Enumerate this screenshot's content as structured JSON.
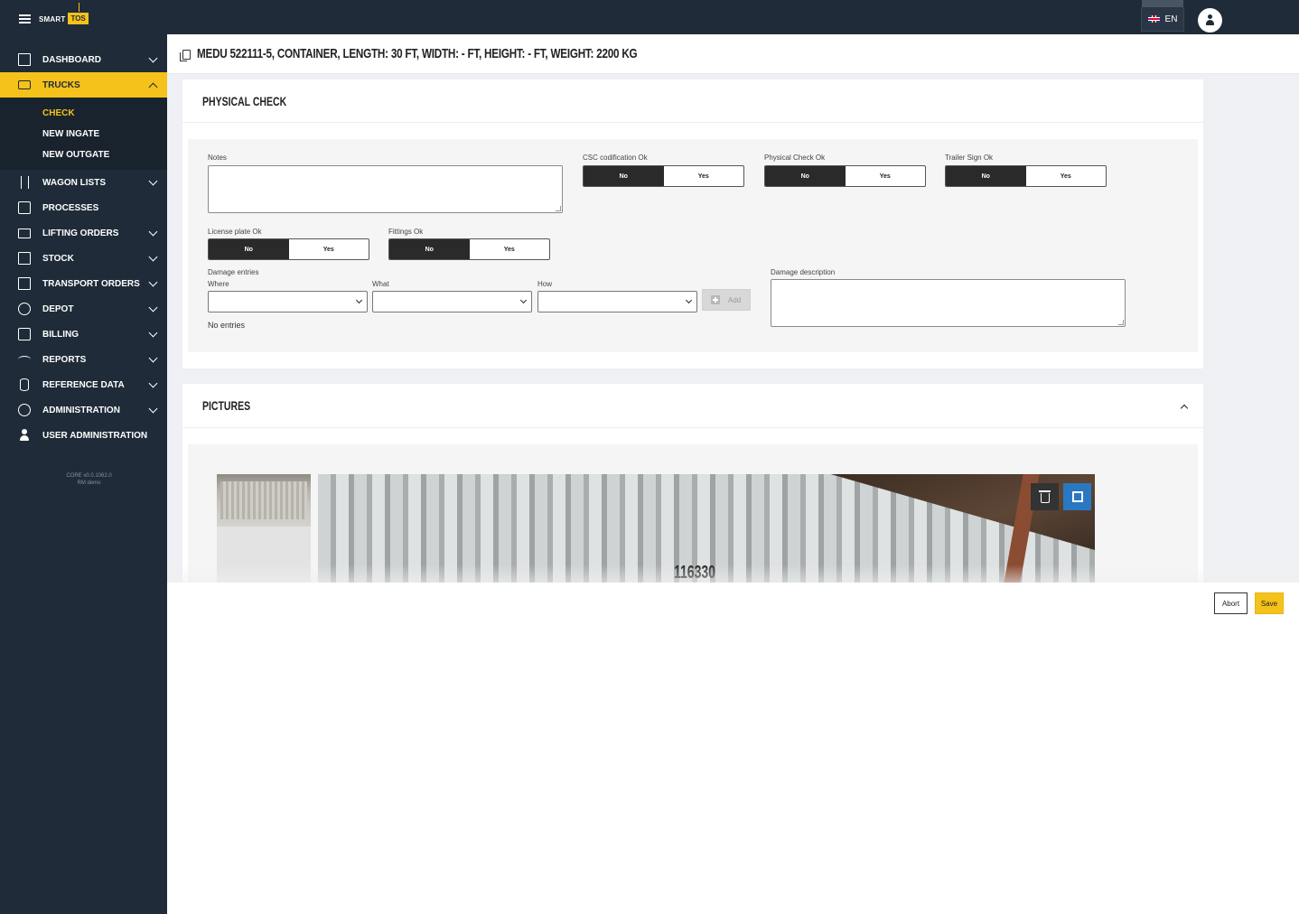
{
  "app": {
    "logo_text_left": "SMART",
    "logo_text_right": "TOS",
    "language": "EN"
  },
  "sidebar": {
    "items": [
      {
        "label": "DASHBOARD",
        "icon": "dashboard-icon"
      },
      {
        "label": "TRUCKS",
        "icon": "truck-icon",
        "active": true
      },
      {
        "label": "WAGON LISTS",
        "icon": "railway-icon"
      },
      {
        "label": "PROCESSES",
        "icon": "process-icon"
      },
      {
        "label": "LIFTING ORDERS",
        "icon": "crane-icon"
      },
      {
        "label": "STOCK",
        "icon": "container-icon"
      },
      {
        "label": "TRANSPORT ORDERS",
        "icon": "calendar-icon"
      },
      {
        "label": "DEPOT",
        "icon": "tools-icon"
      },
      {
        "label": "BILLING",
        "icon": "billing-icon"
      },
      {
        "label": "REPORTS",
        "icon": "gauge-icon"
      },
      {
        "label": "REFERENCE DATA",
        "icon": "database-icon"
      },
      {
        "label": "ADMINISTRATION",
        "icon": "gear-icon"
      },
      {
        "label": "USER ADMINISTRATION",
        "icon": "user-icon"
      }
    ],
    "submenu": [
      {
        "label": "CHECK",
        "current": true
      },
      {
        "label": "NEW INGATE"
      },
      {
        "label": "NEW OUTGATE"
      }
    ],
    "version_line1": "CORE v0.0.1062.0",
    "version_line2": "RM demo"
  },
  "header": {
    "title": "MEDU 522111-5, CONTAINER, LENGTH: 30 FT, WIDTH: - FT, HEIGHT: - FT, WEIGHT: 2200 KG"
  },
  "physical_check": {
    "title": "PHYSICAL CHECK",
    "notes_label": "Notes",
    "csc_label": "CSC codification Ok",
    "physical_label": "Physical Check Ok",
    "trailer_label": "Trailer Sign Ok",
    "license_label": "License plate Ok",
    "fittings_label": "Fittings Ok",
    "no": "No",
    "yes": "Yes",
    "damage_entries_label": "Damage entries",
    "where_label": "Where",
    "what_label": "What",
    "how_label": "How",
    "add_label": "Add",
    "no_entries": "No entries",
    "damage_description_label": "Damage description"
  },
  "pictures": {
    "title": "PICTURES",
    "photo_text": "116330"
  },
  "footer": {
    "abort": "Abort",
    "save": "Save"
  },
  "colors": {
    "sidebar": "#1f2b38",
    "accent": "#f5c21b",
    "expand": "#2a78c2"
  }
}
